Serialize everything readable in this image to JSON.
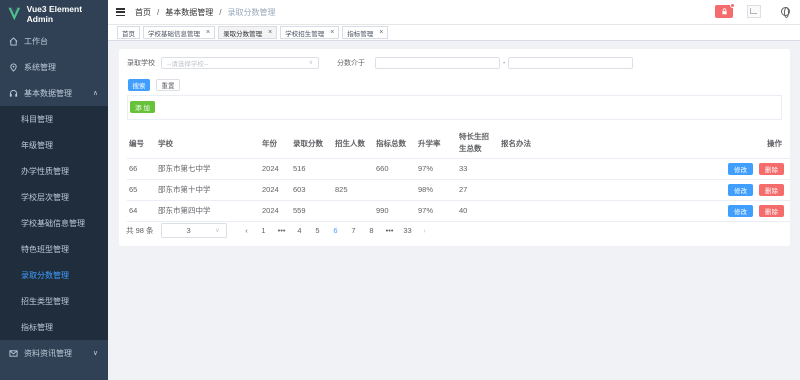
{
  "app": {
    "title": "Vue3 Element Admin"
  },
  "sidebar": {
    "items": [
      {
        "label": "工作台",
        "icon": "home-icon"
      },
      {
        "label": "系统管理",
        "icon": "location-icon"
      },
      {
        "label": "基本数据管理",
        "icon": "headset-icon",
        "arrow": "∧"
      }
    ],
    "submenu": [
      {
        "label": "科目管理"
      },
      {
        "label": "年级管理"
      },
      {
        "label": "办学性质管理"
      },
      {
        "label": "学校层次管理"
      },
      {
        "label": "学校基础信息管理"
      },
      {
        "label": "特色班型管理"
      },
      {
        "label": "录取分数管理",
        "active": true
      },
      {
        "label": "招生类型管理"
      },
      {
        "label": "指标管理"
      }
    ],
    "bottom": {
      "label": "资料资讯管理",
      "arrow": "∨"
    }
  },
  "navbar": {
    "breadcrumb": [
      "首页",
      "基本数据管理",
      "录取分数管理"
    ],
    "lock_icon": "lock-icon",
    "language_icon": "globe-icon"
  },
  "tags": [
    {
      "label": "首页",
      "closable": false
    },
    {
      "label": "学校基础信息管理",
      "closable": true
    },
    {
      "label": "录取分数管理",
      "closable": true,
      "active": true
    },
    {
      "label": "学校招生管理",
      "closable": true
    },
    {
      "label": "指标管理",
      "closable": true
    }
  ],
  "filter": {
    "school_label": "录取学校",
    "school_placeholder": "--请选择学校--",
    "score_label": "分数介于",
    "range_sep": "-",
    "search_label": "搜索",
    "reset_label": "重置"
  },
  "toolbar": {
    "add_label": "添 加"
  },
  "table": {
    "headers": [
      "编号",
      "学校",
      "年份",
      "录取分数",
      "招生人数",
      "指标总数",
      "升学率",
      "特长生招生总数",
      "报名办法",
      "操作"
    ],
    "rows": [
      {
        "id": "66",
        "school": "邵东市第七中学",
        "year": "2024",
        "score": "516",
        "enroll": "",
        "quota": "660",
        "rate": "97%",
        "special": "33",
        "method": ""
      },
      {
        "id": "65",
        "school": "邵东市第十中学",
        "year": "2024",
        "score": "603",
        "enroll": "825",
        "quota": "",
        "rate": "98%",
        "special": "27",
        "method": ""
      },
      {
        "id": "64",
        "school": "邵东市第四中学",
        "year": "2024",
        "score": "559",
        "enroll": "",
        "quota": "990",
        "rate": "97%",
        "special": "40",
        "method": ""
      }
    ],
    "edit_label": "修改",
    "delete_label": "删除"
  },
  "pagination": {
    "total_text": "共 98 条",
    "page_size": "3",
    "prev": "‹",
    "next": "›",
    "pages": [
      "1",
      "•••",
      "4",
      "5",
      "6",
      "7",
      "8",
      "•••",
      "33"
    ],
    "current": "6"
  },
  "colors": {
    "sidebar": "#304156",
    "submenu": "#1f2d3d",
    "primary": "#409eff",
    "success": "#67c23a",
    "danger": "#f56c6c"
  }
}
